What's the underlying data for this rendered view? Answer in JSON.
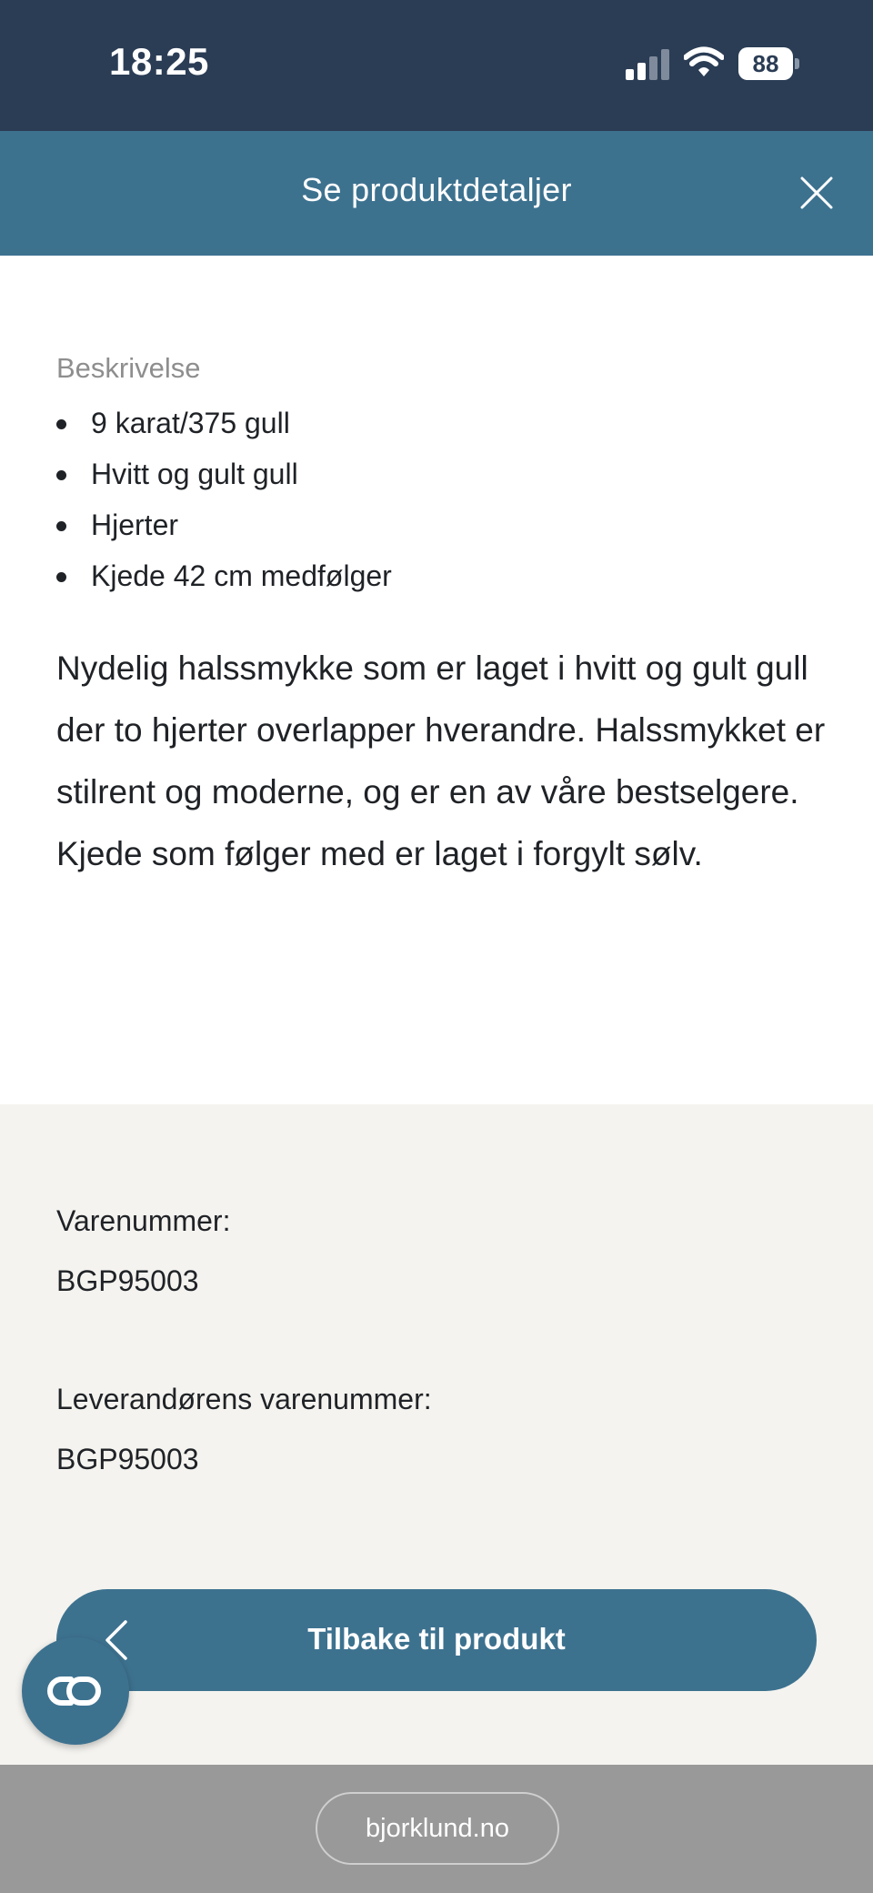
{
  "status_bar": {
    "time": "18:25",
    "battery": "88",
    "icons": [
      "signal-icon",
      "wifi-icon",
      "battery-icon"
    ]
  },
  "header": {
    "title": "Se produktdetaljer",
    "close_icon": "close-icon"
  },
  "description": {
    "label": "Beskrivelse",
    "bullets": [
      "9 karat/375 gull",
      "Hvitt og gult gull",
      "Hjerter",
      "Kjede 42 cm medfølger"
    ],
    "text": "Nydelig halssmykke som er laget i hvitt og gult gull der to hjerter overlapper hverandre. Halssmykket er stilrent og moderne, og er en av våre bestselgere. Kjede som følger med er laget i forgylt sølv."
  },
  "info": {
    "sku_label": "Varenummer:",
    "sku_value": "BGP95003",
    "supplier_sku_label": "Leverandørens varenummer:",
    "supplier_sku_value": "BGP95003"
  },
  "back_button": {
    "label": "Tilbake til produkt",
    "icon": "chevron-left-icon"
  },
  "chat_button": {
    "icon": "chat-link-icon"
  },
  "url_bar": {
    "url": "bjorklund.no"
  },
  "colors": {
    "status_bar": "#2b3d55",
    "primary": "#3d728f",
    "info_background": "#f4f3ef",
    "url_bar": "#999999",
    "text": "#1f2226",
    "muted_label": "#8e8e8e"
  }
}
